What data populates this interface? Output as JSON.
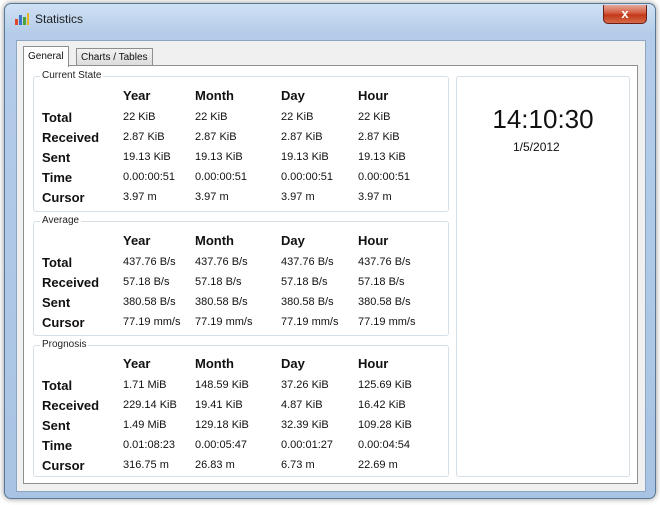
{
  "window": {
    "title": "Statistics",
    "close_glyph": "x",
    "icon": "bar-chart-icon",
    "colors": {
      "frame": "#a9c3e4",
      "close": "#c13919"
    }
  },
  "tabs": [
    "General",
    "Charts / Tables"
  ],
  "columns": [
    "Year",
    "Month",
    "Day",
    "Hour"
  ],
  "groups": [
    {
      "title": "Current State",
      "rows": [
        {
          "label": "Total",
          "values": [
            "22 KiB",
            "22 KiB",
            "22 KiB",
            "22 KiB"
          ]
        },
        {
          "label": "Received",
          "values": [
            "2.87 KiB",
            "2.87 KiB",
            "2.87 KiB",
            "2.87 KiB"
          ]
        },
        {
          "label": "Sent",
          "values": [
            "19.13 KiB",
            "19.13 KiB",
            "19.13 KiB",
            "19.13 KiB"
          ]
        },
        {
          "label": "Time",
          "values": [
            "0.00:00:51",
            "0.00:00:51",
            "0.00:00:51",
            "0.00:00:51"
          ]
        },
        {
          "label": "Cursor",
          "values": [
            "3.97 m",
            "3.97 m",
            "3.97 m",
            "3.97 m"
          ]
        }
      ]
    },
    {
      "title": "Average",
      "rows": [
        {
          "label": "Total",
          "values": [
            "437.76 B/s",
            "437.76 B/s",
            "437.76 B/s",
            "437.76 B/s"
          ]
        },
        {
          "label": "Received",
          "values": [
            "57.18 B/s",
            "57.18 B/s",
            "57.18 B/s",
            "57.18 B/s"
          ]
        },
        {
          "label": "Sent",
          "values": [
            "380.58 B/s",
            "380.58 B/s",
            "380.58 B/s",
            "380.58 B/s"
          ]
        },
        {
          "label": "Cursor",
          "values": [
            "77.19 mm/s",
            "77.19 mm/s",
            "77.19 mm/s",
            "77.19 mm/s"
          ]
        }
      ]
    },
    {
      "title": "Prognosis",
      "rows": [
        {
          "label": "Total",
          "values": [
            "1.71 MiB",
            "148.59 KiB",
            "37.26 KiB",
            "125.69 KiB"
          ]
        },
        {
          "label": "Received",
          "values": [
            "229.14 KiB",
            "19.41 KiB",
            "4.87 KiB",
            "16.42 KiB"
          ]
        },
        {
          "label": "Sent",
          "values": [
            "1.49 MiB",
            "129.18 KiB",
            "32.39 KiB",
            "109.28 KiB"
          ]
        },
        {
          "label": "Time",
          "values": [
            "0.01:08:23",
            "0.00:05:47",
            "0.00:01:27",
            "0.00:04:54"
          ]
        },
        {
          "label": "Cursor",
          "values": [
            "316.75 m",
            "26.83 m",
            "6.73 m",
            "22.69 m"
          ]
        }
      ]
    }
  ],
  "clock": {
    "time": "14:10:30",
    "date": "1/5/2012"
  }
}
